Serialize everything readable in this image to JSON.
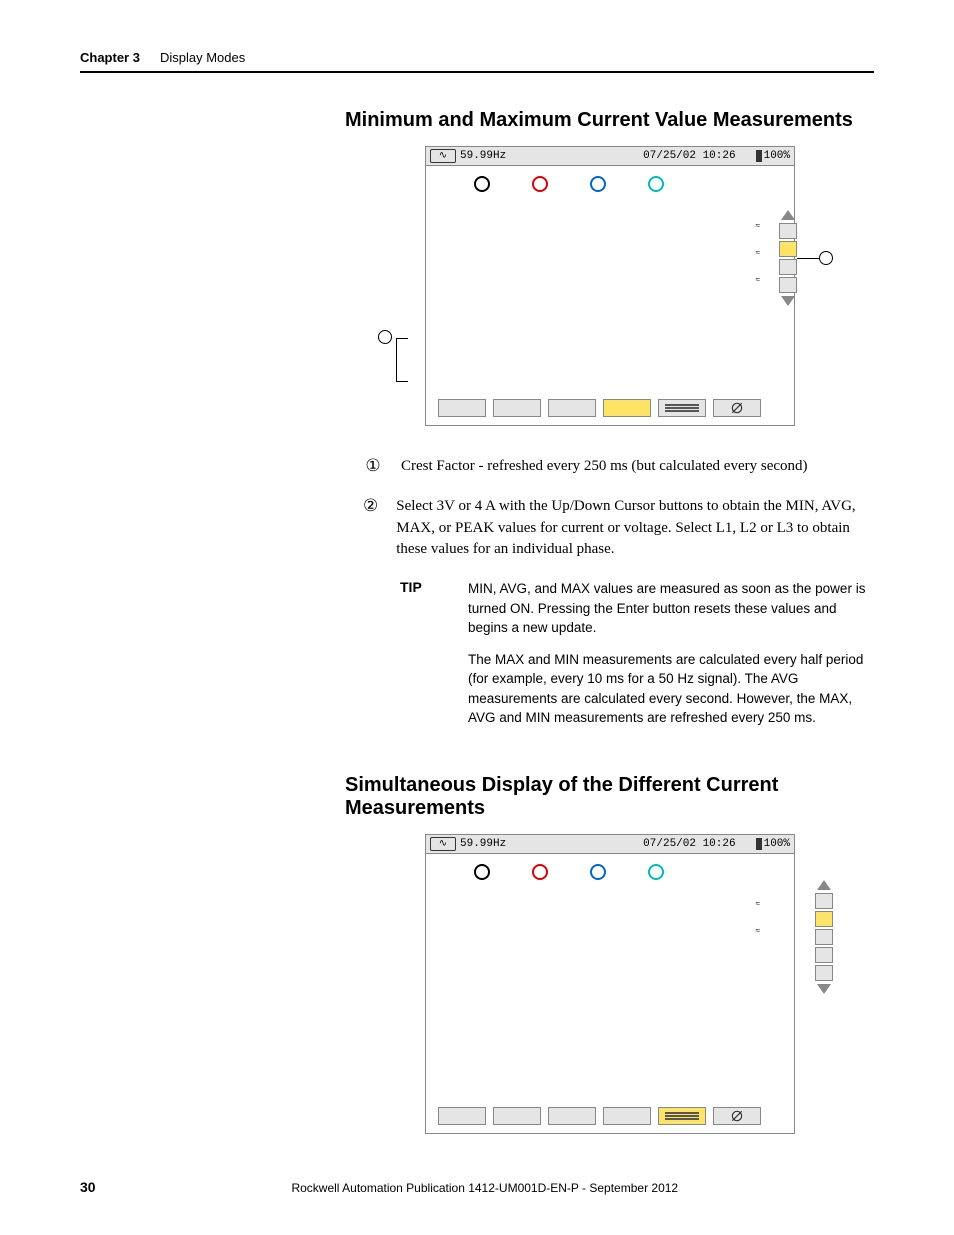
{
  "header": {
    "chapter": "Chapter 3",
    "title": "Display Modes"
  },
  "section1": {
    "title": "Minimum and Maximum Current Value Measurements"
  },
  "section2": {
    "title": "Simultaneous Display of the Different Current Measurements"
  },
  "status": {
    "freq": "59.99Hz",
    "datetime": "07/25/02 10:26",
    "battery": "100%"
  },
  "axis": {
    "l1": "≈",
    "l2": "≈",
    "l3": "≈"
  },
  "notes": {
    "n1": "Crest Factor - refreshed every 250 ms (but calculated every second)",
    "n2": "Select 3V or 4 A with the Up/Down Cursor buttons to obtain the MIN, AVG, MAX, or PEAK values for current or voltage. Select L1, L2 or L3 to obtain these values for an individual phase."
  },
  "tip": {
    "label": "TIP",
    "p1": "MIN, AVG, and MAX values are measured as soon as the power is turned ON. Pressing the Enter button resets these values and begins a new update.",
    "p2": "The MAX and MIN measurements are calculated every half period (for example, every 10 ms for a 50 Hz signal). The AVG measurements are calculated every second. However, the MAX, AVG and MIN measurements are refreshed every 250 ms."
  },
  "circled": {
    "one": "①",
    "two": "②"
  },
  "footer": {
    "page": "30",
    "pub": "Rockwell Automation Publication 1412-UM001D-EN-P - September 2012"
  }
}
